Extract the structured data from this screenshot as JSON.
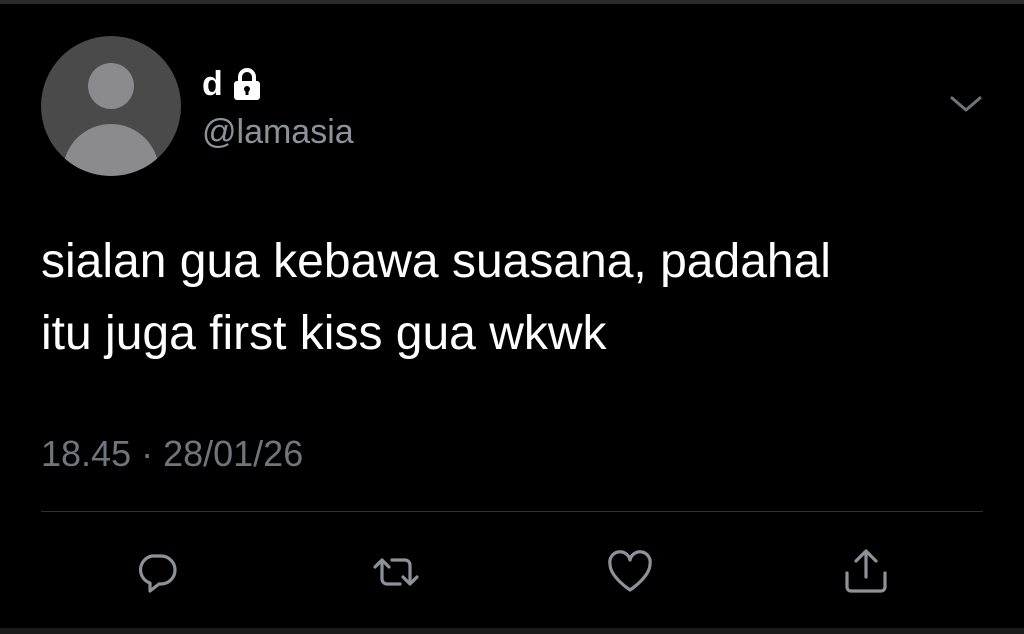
{
  "tweet": {
    "display_name": "d",
    "handle": "@lamasia",
    "text_lines": [
      "sialan gua kebawa suasana, padahal",
      "itu juga first kiss gua wkwk"
    ],
    "time": "18.45",
    "separator": "·",
    "date": "28/01/26",
    "protected": true
  },
  "icons": {
    "lock": "lock-icon",
    "caret": "chevron-down-icon",
    "reply": "reply-icon",
    "retweet": "retweet-icon",
    "like": "heart-icon",
    "share": "share-icon"
  },
  "colors": {
    "background": "#000000",
    "text": "#ffffff",
    "secondary": "#6e767d",
    "icon": "#8b9299",
    "divider": "#2f3336",
    "avatar_bg": "#4a4a4b",
    "avatar_fg": "#8b8b8d"
  }
}
